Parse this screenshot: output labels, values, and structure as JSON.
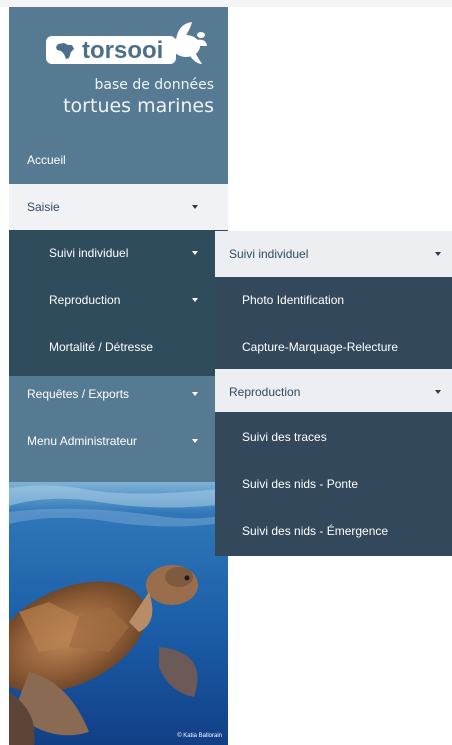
{
  "logo": {
    "brand": "torsooi",
    "subtitle_line1": "base de données",
    "subtitle_line2": "tortues marines"
  },
  "nav": {
    "items": [
      {
        "label": "Accueil",
        "active": false,
        "has_caret": false
      },
      {
        "label": "Saisie",
        "active": true,
        "has_caret": true
      },
      {
        "label": "Requêtes / Exports",
        "active": false,
        "has_caret": true
      },
      {
        "label": "Menu Administrateur",
        "active": false,
        "has_caret": true
      }
    ],
    "saisie_submenu": [
      {
        "label": "Suivi individuel",
        "has_caret": true
      },
      {
        "label": "Reproduction",
        "has_caret": true
      },
      {
        "label": "Mortalité / Détresse",
        "has_caret": false
      }
    ]
  },
  "flyouts": [
    {
      "heading": "Suivi individuel",
      "items": [
        "Photo Identification",
        "Capture-Marquage-Relecture"
      ]
    },
    {
      "heading": "Reproduction",
      "items": [
        "Suivi des traces",
        "Suivi des nids - Ponte",
        "Suivi des nids - Émergence"
      ]
    }
  ],
  "photo": {
    "credit": "© Katia Ballorain"
  },
  "colors": {
    "sidebar": "#577a93",
    "submenu": "#2f4c5d",
    "flyout_panel": "#33485a",
    "active_bg": "#f1f2f5"
  }
}
